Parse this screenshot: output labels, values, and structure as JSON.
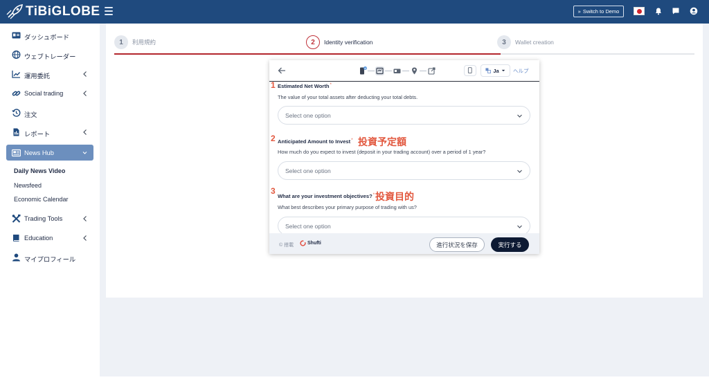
{
  "brand": {
    "logo_text": "TiBiGLOBE"
  },
  "header": {
    "switch_demo_label": "Switch to Demo",
    "icons": [
      "menu-icon",
      "japan-flag-icon",
      "bell-icon",
      "chat-icon",
      "user-circle-icon"
    ]
  },
  "sidebar": {
    "items": [
      {
        "label": "ダッシュボード",
        "icon": "id-card-icon"
      },
      {
        "label": "ウェブトレーダー",
        "icon": "globe-icon"
      },
      {
        "label": "運用委託",
        "icon": "chart-up-icon"
      },
      {
        "label": "Social trading",
        "icon": "link-icon"
      },
      {
        "label": "注文",
        "icon": "history-icon"
      },
      {
        "label": "レポート",
        "icon": "report-icon"
      },
      {
        "label": "News Hub",
        "icon": "newspaper-icon"
      },
      {
        "label": "Trading Tools",
        "icon": "tools-icon"
      },
      {
        "label": "Education",
        "icon": "book-icon"
      },
      {
        "label": "マイプロフィール",
        "icon": "person-icon"
      }
    ],
    "news_hub_sub": [
      "Daily News Video",
      "Newsfeed",
      "Economic Calendar"
    ]
  },
  "steps": [
    {
      "num": "1",
      "label": "利用規約"
    },
    {
      "num": "2",
      "label": "Identity verification"
    },
    {
      "num": "3",
      "label": "Wallet creation"
    }
  ],
  "verification": {
    "lang": "Ja",
    "help": "ヘルプ",
    "questions": [
      {
        "num": "1",
        "title": "Estimated Net Worth",
        "desc": "The value of your total assets after deducting your total debts.",
        "placeholder": "Select one option",
        "annotation": ""
      },
      {
        "num": "2",
        "title": "Anticipated Amount to Invest",
        "desc": "How much do you expect to invest (deposit in your trading account) over a period of 1 year?",
        "placeholder": "Select one option",
        "annotation": "投資予定額"
      },
      {
        "num": "3",
        "title": "What are your investment objectives?",
        "desc": "What best describes your primary purpose of trading with us?",
        "placeholder": "Select one option",
        "annotation": "投資目的"
      }
    ],
    "required_mark": "*",
    "footer": {
      "powered_label": "© 搭載",
      "provider": "Shufti",
      "save_label": "進行状況を保存",
      "execute_label": "実行する"
    }
  },
  "colors": {
    "topbar": "#1f4a7e",
    "accent_red": "#b3262d",
    "annotation": "#e2583f",
    "active_nav": "#6c8fbe"
  }
}
